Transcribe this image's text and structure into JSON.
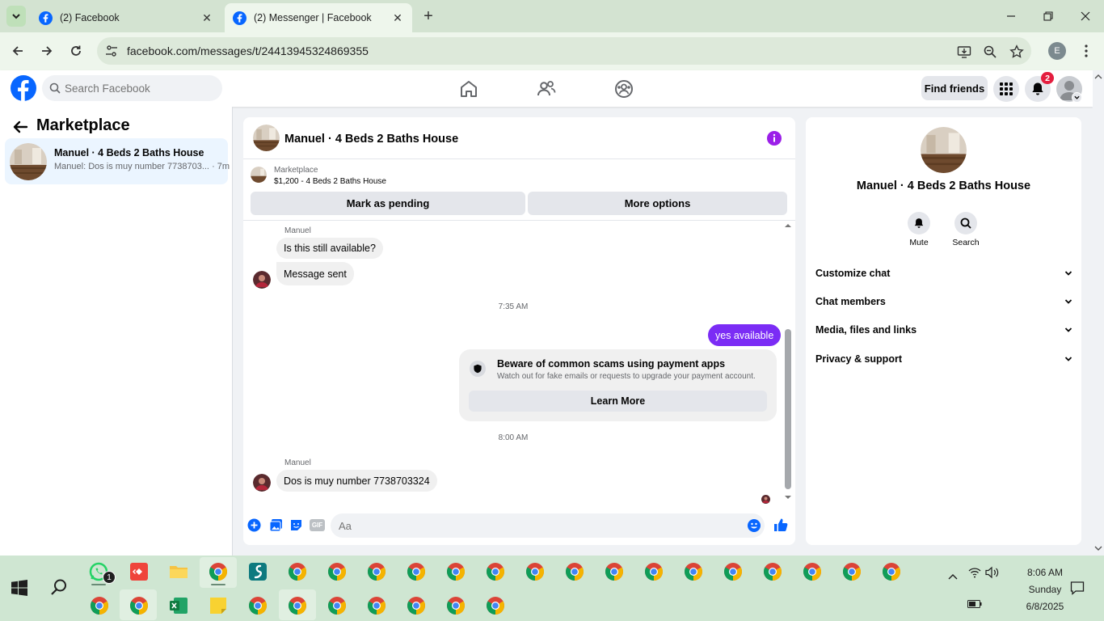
{
  "browser": {
    "tabs": [
      {
        "title": "(2) Facebook"
      },
      {
        "title": "(2) Messenger | Facebook"
      }
    ],
    "url": "facebook.com/messages/t/24413945324869355"
  },
  "fb_header": {
    "search_placeholder": "Search Facebook",
    "find_friends": "Find friends",
    "notification_count": "2",
    "profile_initial": "E"
  },
  "sidebar": {
    "title": "Marketplace",
    "conversation": {
      "name": "Manuel · 4 Beds 2 Baths House",
      "preview": "Manuel: Dos is muy number 7738703...",
      "time": "· 7m"
    }
  },
  "chat": {
    "header_name": "Manuel · 4 Beds 2 Baths House",
    "marketplace_label": "Marketplace",
    "listing": "$1,200 - 4 Beds 2 Baths House",
    "mark_pending": "Mark as pending",
    "more_options": "More options",
    "messages": {
      "sender1": "Manuel",
      "m1": "Is this still available?",
      "m2": "Message sent",
      "time1": "7:35 AM",
      "m3": "yes available",
      "scam_title": "Beware of common scams using payment apps",
      "scam_sub": "Watch out for fake emails or requests to upgrade your payment account.",
      "learn_more": "Learn More",
      "time2": "8:00 AM",
      "sender2": "Manuel",
      "m4": "Dos is muy number 7738703324"
    },
    "composer_placeholder": "Aa",
    "gif_label": "GIF"
  },
  "info_panel": {
    "name": "Manuel · 4 Beds 2 Baths House",
    "mute": "Mute",
    "search": "Search",
    "sections": [
      "Customize chat",
      "Chat members",
      "Media, files and links",
      "Privacy & support"
    ]
  },
  "taskbar": {
    "whatsapp_badge": "1",
    "time": "8:06 AM",
    "day": "Sunday",
    "date": "6/8/2025"
  },
  "colors": {
    "fb_blue": "#0866ff",
    "my_bubble": "#7b2cf5",
    "info_icon": "#9b1fe8",
    "badge_red": "#e41e3f"
  }
}
